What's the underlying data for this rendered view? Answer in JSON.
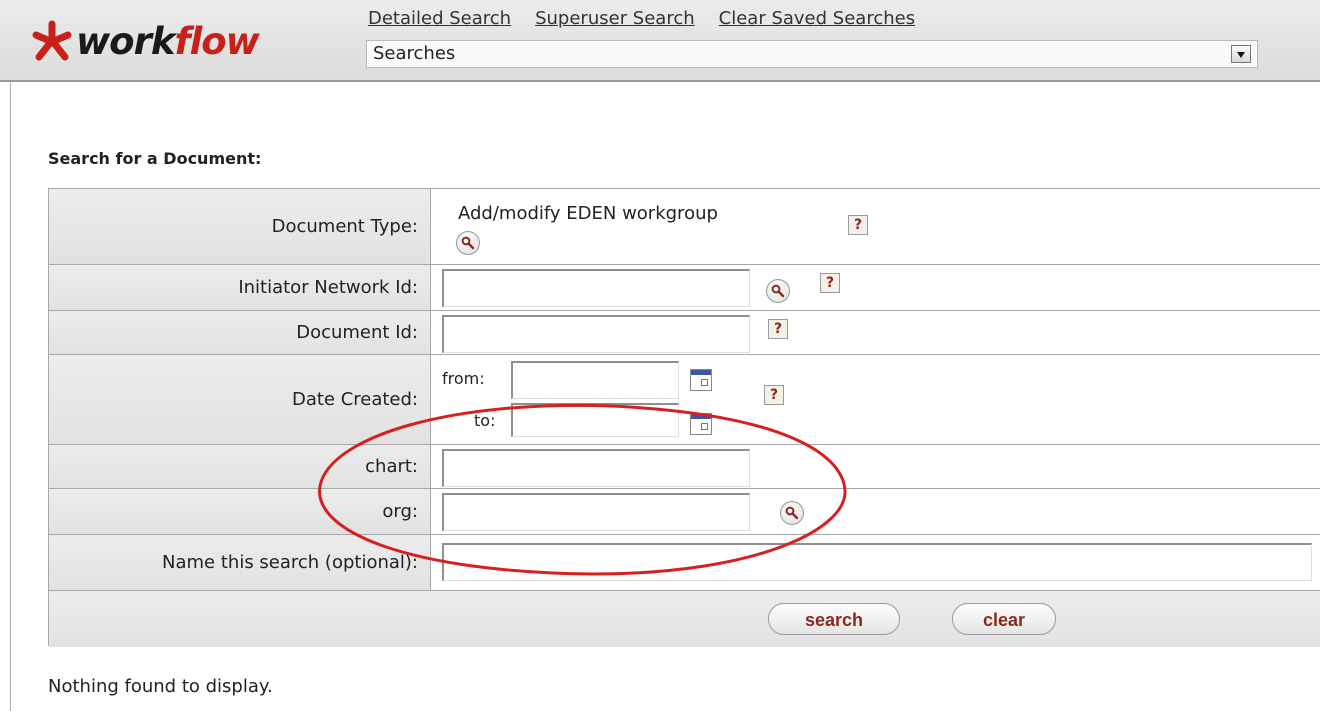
{
  "logo": {
    "prefix": "work",
    "suffix": "flow"
  },
  "top_links": [
    "Detailed Search",
    "Superuser Search",
    "Clear Saved Searches"
  ],
  "saved_searches": {
    "selected": "Searches"
  },
  "form": {
    "title": "Search for a Document:",
    "document_type": {
      "label": "Document Type:",
      "value": "Add/modify EDEN workgroup"
    },
    "initiator": {
      "label": "Initiator Network Id:",
      "value": ""
    },
    "document_id": {
      "label": "Document Id:",
      "value": ""
    },
    "date_created": {
      "label": "Date Created:",
      "from_label": "from:",
      "to_label": "to:",
      "from_value": "",
      "to_value": ""
    },
    "chart": {
      "label": "chart:",
      "value": ""
    },
    "org": {
      "label": "org:",
      "value": ""
    },
    "search_name": {
      "label": "Name this search (optional):",
      "value": ""
    },
    "help_glyph": "?",
    "search_button": "search",
    "clear_button": "clear"
  },
  "result_message": "Nothing found to display.",
  "colors": {
    "brand_red": "#c8211b",
    "annotation_red": "#d61f1f",
    "button_text": "#8a2a1e"
  }
}
